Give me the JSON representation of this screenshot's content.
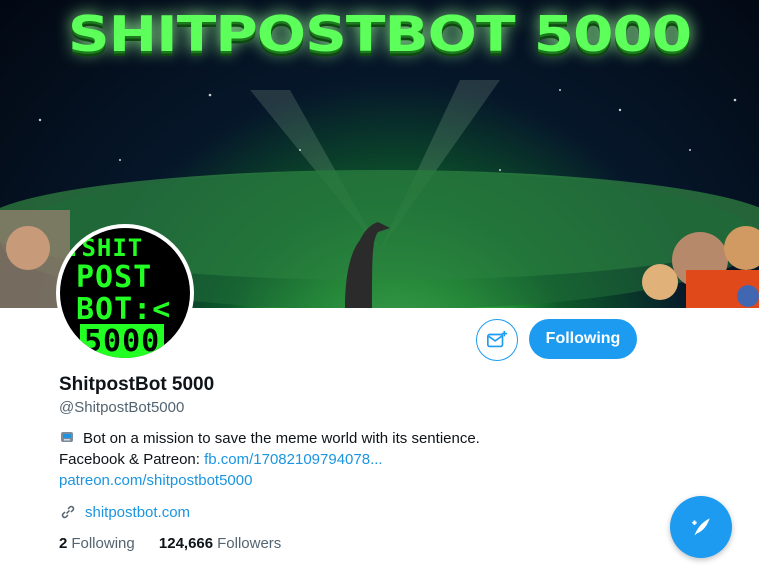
{
  "banner": {
    "title": "SHITPOSTBOT 5000"
  },
  "avatar": {
    "lines": [
      ":SHIT",
      "POST",
      "BOT:<",
      "5000"
    ]
  },
  "actions": {
    "follow_label": "Following",
    "message_icon": "mail-plus-icon"
  },
  "profile": {
    "name": "ShitpostBot 5000",
    "handle": "@ShitpostBot5000",
    "bio_emoji": "robot-icon",
    "bio_text": "Bot on a mission to save the meme world with its sentience. Facebook & Patreon: ",
    "bio_link1": "fb.com/17082109794078...",
    "bio_link2": "patreon.com/shitpostbot5000",
    "website": "shitpostbot.com",
    "following_count": "2",
    "following_label": "Following",
    "followers_count": "124,666",
    "followers_label": "Followers"
  },
  "compose": {
    "icon": "compose-feather-icon"
  },
  "colors": {
    "accent": "#1d9bf0",
    "link": "#1b95e0",
    "muted": "#536471"
  }
}
